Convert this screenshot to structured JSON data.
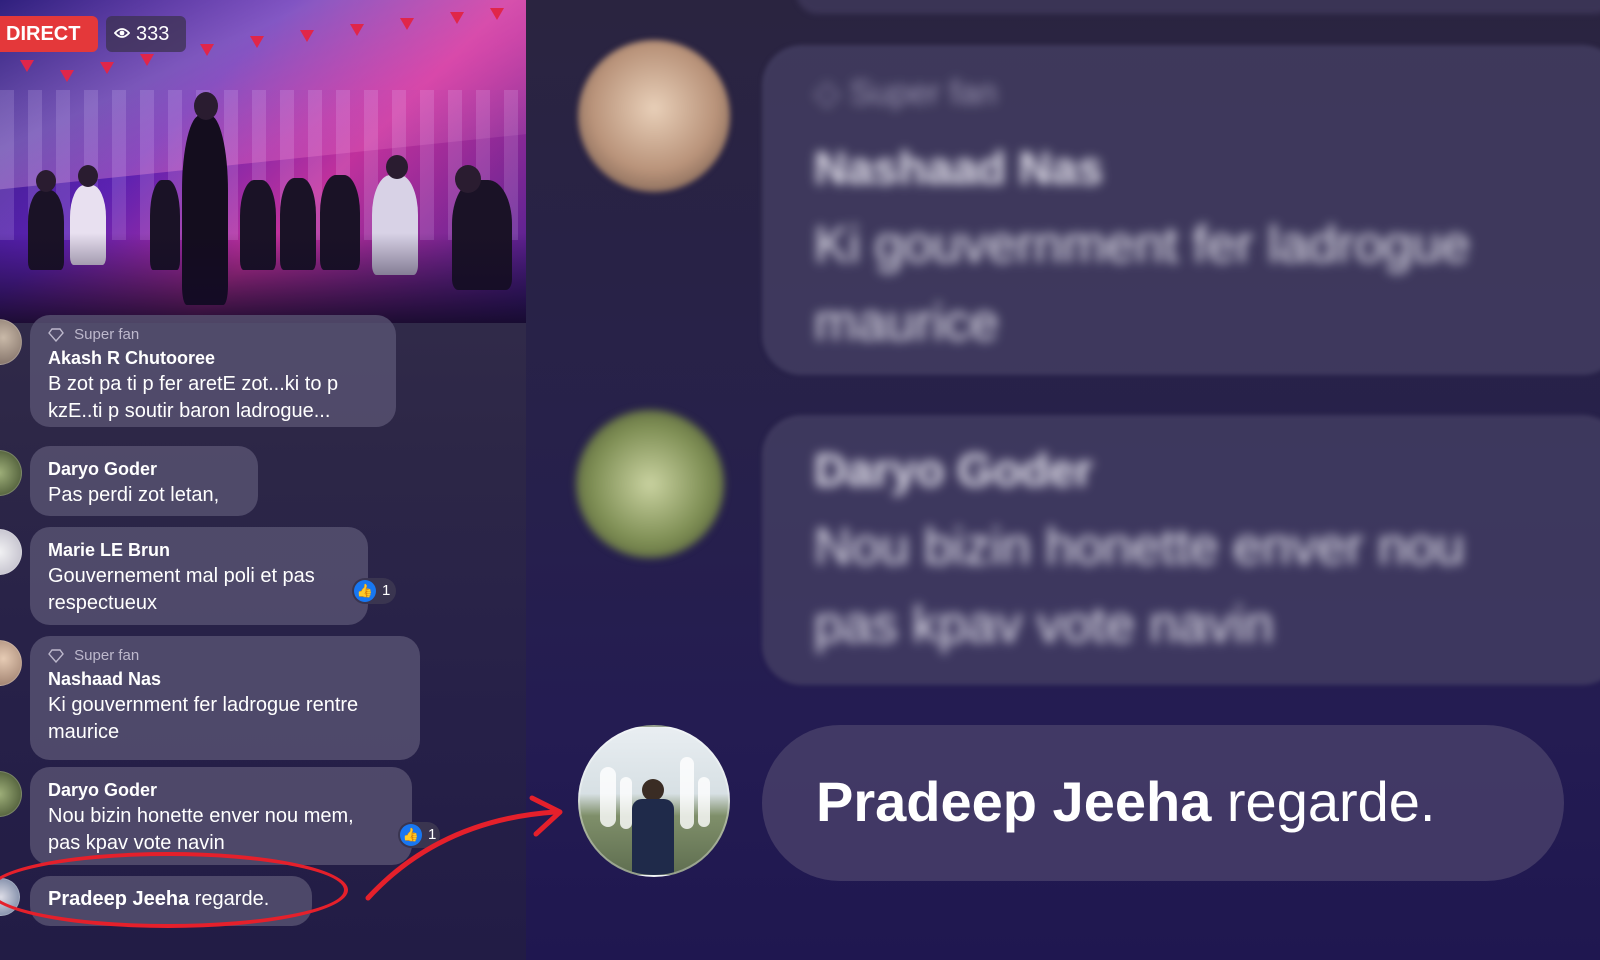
{
  "live": {
    "badge_label": "DIRECT",
    "viewer_count": "333",
    "eye_icon": "eye-icon"
  },
  "comments": [
    {
      "superfan": true,
      "superfan_label": "Super fan",
      "name": "Akash R Chutooree",
      "lines": [
        "B zot pa ti p fer aretE zot...ki to p",
        "kzE..ti p soutir baron ladrogue..."
      ],
      "likes": null
    },
    {
      "superfan": false,
      "name": "Daryo Goder",
      "lines": [
        "Pas perdi zot letan,"
      ],
      "likes": null
    },
    {
      "superfan": false,
      "name": "Marie LE Brun",
      "lines": [
        "Gouvernement mal poli et pas",
        "respectueux"
      ],
      "likes": "1"
    },
    {
      "superfan": true,
      "superfan_label": "Super fan",
      "name": "Nashaad Nas",
      "lines": [
        "Ki gouvernment fer ladrogue rentre",
        "maurice"
      ],
      "likes": null
    },
    {
      "superfan": false,
      "name": "Daryo Goder",
      "lines": [
        "Nou bizin honette enver nou mem,",
        "pas kpav vote navin"
      ],
      "likes": "1"
    }
  ],
  "joined": {
    "name": "Pradeep Jeeha",
    "action": " regarde."
  },
  "zoom": {
    "c1": {
      "superfan_label": "Super fan",
      "name": "Nashaad Nas",
      "line1": "Ki gouvernment fer ladrogue",
      "line2": "maurice"
    },
    "c2": {
      "name": "Daryo Goder",
      "line1": "Nou bizin honette enver nou",
      "line2": "pas kpav vote navin"
    },
    "joined_name": "Pradeep Jeeha",
    "joined_action": " regarde."
  },
  "colors": {
    "live_red": "#e4383a",
    "highlight_red": "#e5202b",
    "like_blue": "#1877f2"
  }
}
